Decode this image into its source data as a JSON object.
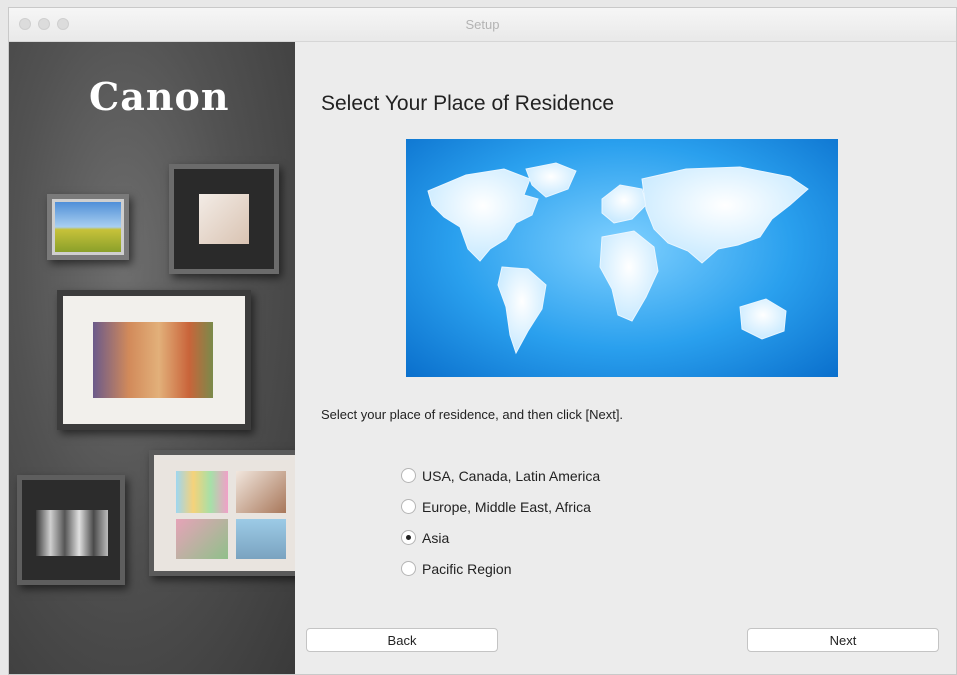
{
  "window": {
    "title": "Setup"
  },
  "sidebar": {
    "brand": "Canon"
  },
  "main": {
    "heading": "Select Your Place of Residence",
    "instruction": "Select your place of residence, and then click [Next].",
    "options": [
      {
        "label": "USA, Canada, Latin America",
        "selected": false
      },
      {
        "label": "Europe, Middle East, Africa",
        "selected": false
      },
      {
        "label": "Asia",
        "selected": true
      },
      {
        "label": "Pacific Region",
        "selected": false
      }
    ]
  },
  "buttons": {
    "back": "Back",
    "next": "Next"
  },
  "colors": {
    "map_blue": "#2aa0ee",
    "sidebar_gray": "#525252"
  },
  "icons": [
    "world-map-icon",
    "radio-button-icon"
  ]
}
